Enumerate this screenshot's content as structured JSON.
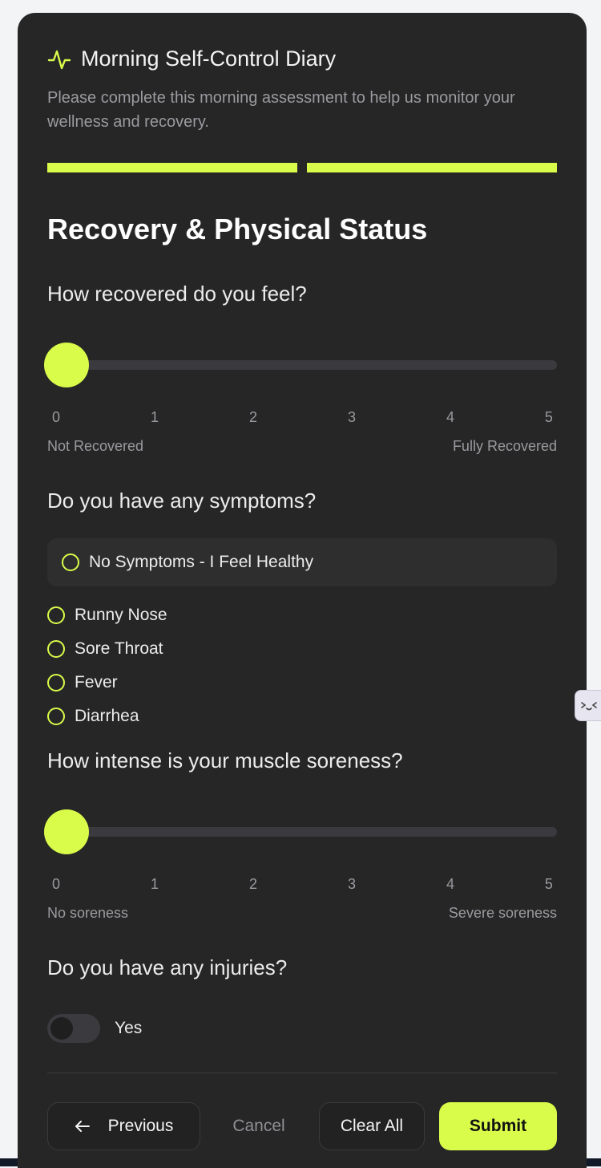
{
  "header": {
    "title": "Morning Self-Control Diary",
    "subtitle": "Please complete this morning assessment to help us monitor your wellness and recovery.",
    "icon": "activity-pulse-icon"
  },
  "progress": {
    "steps_total": 2,
    "steps_filled": 2
  },
  "section_title": "Recovery & Physical Status",
  "recovery": {
    "question": "How recovered do you feel?",
    "value": 0,
    "ticks": [
      "0",
      "1",
      "2",
      "3",
      "4",
      "5"
    ],
    "min_label": "Not Recovered",
    "max_label": "Fully Recovered"
  },
  "symptoms": {
    "question": "Do you have any symptoms?",
    "none_option": "No Symptoms - I Feel Healthy",
    "options": [
      "Runny Nose",
      "Sore Throat",
      "Fever",
      "Diarrhea"
    ]
  },
  "soreness": {
    "question": "How intense is your muscle soreness?",
    "value": 0,
    "ticks": [
      "0",
      "1",
      "2",
      "3",
      "4",
      "5"
    ],
    "min_label": "No soreness",
    "max_label": "Severe soreness"
  },
  "injuries": {
    "question": "Do you have any injuries?",
    "toggle_label": "Yes",
    "toggle_on": false
  },
  "actions": {
    "previous": "Previous",
    "cancel": "Cancel",
    "clear_all": "Clear All",
    "submit": "Submit"
  },
  "colors": {
    "accent": "#d9fb4a",
    "card": "#262626",
    "page": "#f3f4f6"
  }
}
